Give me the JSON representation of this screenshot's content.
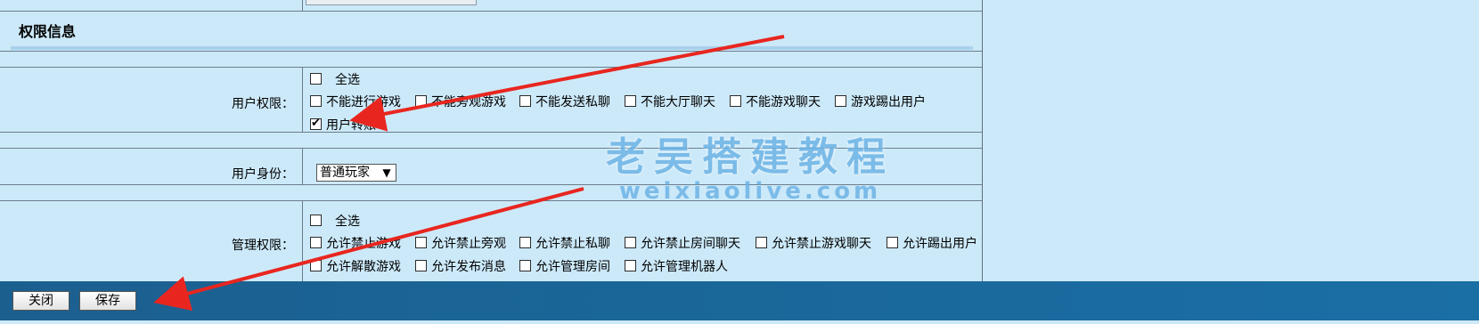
{
  "section": {
    "title": "权限信息"
  },
  "user_permissions": {
    "label": "用户权限：",
    "select_all": {
      "label": "全选",
      "checked": false
    },
    "options": [
      {
        "label": "不能进行游戏",
        "checked": false
      },
      {
        "label": "不能旁观游戏",
        "checked": false
      },
      {
        "label": "不能发送私聊",
        "checked": false
      },
      {
        "label": "不能大厅聊天",
        "checked": false
      },
      {
        "label": "不能游戏聊天",
        "checked": false
      },
      {
        "label": "游戏踢出用户",
        "checked": false
      },
      {
        "label": "用户转账",
        "checked": true
      }
    ]
  },
  "user_identity": {
    "label": "用户身份：",
    "selected": "普通玩家"
  },
  "admin_permissions": {
    "label": "管理权限：",
    "select_all": {
      "label": "全选",
      "checked": false
    },
    "options": [
      {
        "label": "允许禁止游戏",
        "checked": false
      },
      {
        "label": "允许禁止旁观",
        "checked": false
      },
      {
        "label": "允许禁止私聊",
        "checked": false
      },
      {
        "label": "允许禁止房间聊天",
        "checked": false
      },
      {
        "label": "允许禁止游戏聊天",
        "checked": false
      },
      {
        "label": "允许踢出用户",
        "checked": false
      },
      {
        "label": "允许解散游戏",
        "checked": false
      },
      {
        "label": "允许发布消息",
        "checked": false
      },
      {
        "label": "允许管理房间",
        "checked": false
      },
      {
        "label": "允许管理机器人",
        "checked": false
      }
    ]
  },
  "footer": {
    "close_label": "关闭",
    "save_label": "保存"
  },
  "watermark": {
    "line1": "老吴搭建教程",
    "line2": "weixiaolive.com"
  },
  "colors": {
    "background": "#cce9f9",
    "footer": "#1a6fa5",
    "arrow": "#e8261f"
  }
}
